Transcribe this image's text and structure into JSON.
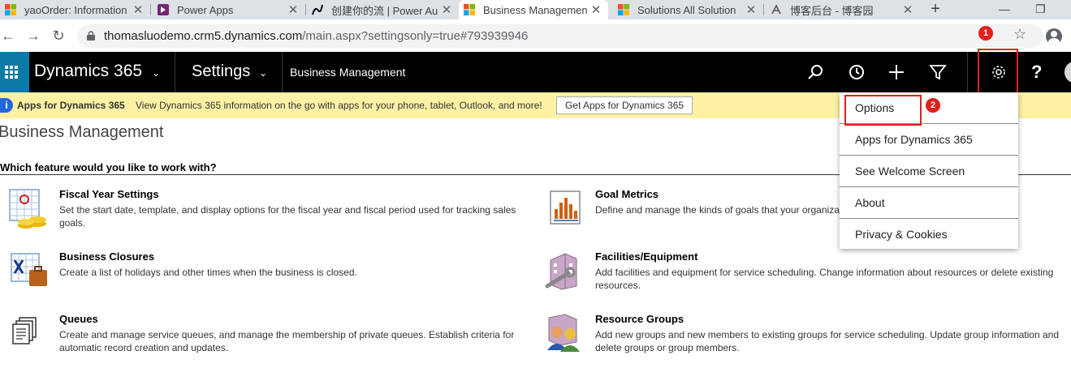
{
  "browser": {
    "tabs": [
      {
        "title": "yaoOrder: Information",
        "icon": "microsoft-logo"
      },
      {
        "title": "Power Apps",
        "icon": "power-apps-logo"
      },
      {
        "title": "创建你的流 | Power Au",
        "icon": "power-automate-logo"
      },
      {
        "title": "Business Managemen",
        "icon": "microsoft-logo",
        "active": true
      },
      {
        "title": "Solutions All Solution",
        "icon": "microsoft-logo"
      },
      {
        "title": "博客后台 - 博客园",
        "icon": "cnblogs-logo"
      }
    ],
    "url_host": "thomasluodemo.crm5.dynamics.com",
    "url_path": "/main.aspx?settingsonly=true#793939946"
  },
  "annotations": {
    "badge1": "1",
    "badge2": "2"
  },
  "navbar": {
    "brand": "Dynamics 365",
    "area": "Settings",
    "breadcrumb": "Business Management"
  },
  "notification": {
    "title": "Apps for Dynamics 365",
    "message": "View Dynamics 365 information on the go with apps for your phone, tablet, Outlook, and more!",
    "button": "Get Apps for Dynamics 365"
  },
  "page": {
    "title": "Business Management",
    "question": "Which feature would you like to work with?",
    "features": [
      {
        "name": "Fiscal Year Settings",
        "desc": "Set the start date, template, and display options for the fiscal year and fiscal period used for tracking sales goals."
      },
      {
        "name": "Goal Metrics",
        "desc": "Define and manage the kinds of goals that your organization tracks."
      },
      {
        "name": "Business Closures",
        "desc": "Create a list of holidays and other times when the business is closed."
      },
      {
        "name": "Facilities/Equipment",
        "desc": "Add facilities and equipment for service scheduling. Change information about resources or delete existing resources."
      },
      {
        "name": "Queues",
        "desc": "Create and manage service queues, and manage the membership of private queues. Establish criteria for automatic record creation and updates."
      },
      {
        "name": "Resource Groups",
        "desc": "Add new groups and new members to existing groups for service scheduling. Update group information and delete groups or group members."
      }
    ]
  },
  "menu": {
    "items": [
      "Options",
      "Apps for Dynamics 365",
      "See Welcome Screen",
      "About",
      "Privacy & Cookies"
    ]
  },
  "colors": {
    "accent": "#0b7aa6",
    "highlight": "#e0201b",
    "notify_bg": "#fdf1a5"
  }
}
